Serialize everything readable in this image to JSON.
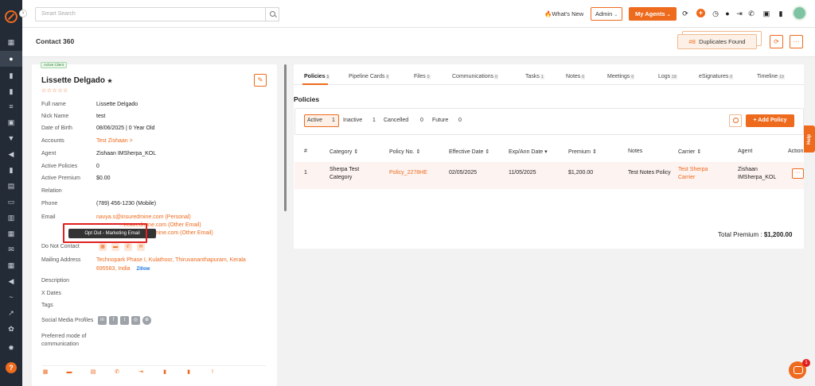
{
  "topbar": {
    "search_placeholder": "Smart Search",
    "whats_new": "What's New",
    "role": "Admin",
    "my_agents": "My Agents"
  },
  "header": {
    "title": "Contact 360",
    "duplicates_count": "#8",
    "duplicates_label": "Duplicates Found"
  },
  "contact": {
    "status": "Active Client",
    "name": "Lissette Delgado",
    "stars": "☆☆☆☆☆",
    "fields": [
      {
        "label": "Full name",
        "value": "Lissette Delgado"
      },
      {
        "label": "Nick Name",
        "value": "test"
      },
      {
        "label": "Date of Birth",
        "value": "08/06/2025 | 0 Year Old"
      },
      {
        "label": "Accounts",
        "value": "Test Zishaan >"
      },
      {
        "label": "Agent",
        "value": "Zishaan IMSherpa_KOL"
      },
      {
        "label": "Active Policies",
        "value": "0"
      },
      {
        "label": "Active Premium",
        "value": "$0.00"
      },
      {
        "label": "Relation",
        "value": ""
      },
      {
        "label": "Phone",
        "value": "(789) 456-1230 (Mobile)"
      }
    ],
    "email_label": "Email",
    "emails": [
      "navya.s@insuredmine.com  (Personal)",
      "...insuredmine.com  (Other Email)",
      "...mine.com  (Other Email)"
    ],
    "tooltip": "Opt Out - Marketing Email",
    "dnc_label": "Do Not Contact",
    "mailing_label": "Mailing Address",
    "mailing_line1": "Technopark Phase I, Kulathoor, Thiruvananthapuram, Kerala",
    "mailing_line2": "695583, India",
    "zillow": "Zillow",
    "description_label": "Description",
    "xdates_label": "X Dates",
    "tags_label": "Tags",
    "social_label": "Social Media Profiles",
    "preferred_label1": "Preferred mode of",
    "preferred_label2": "communication"
  },
  "tabs": [
    {
      "label": "Policies",
      "count": "1"
    },
    {
      "label": "Pipeline Cards",
      "count": "0"
    },
    {
      "label": "Files",
      "count": "0"
    },
    {
      "label": "Communications",
      "count": "0"
    },
    {
      "label": "Tasks",
      "count": "1"
    },
    {
      "label": "Notes",
      "count": "0"
    },
    {
      "label": "Meetings",
      "count": "0"
    },
    {
      "label": "Logs",
      "count": "18"
    },
    {
      "label": "eSignatures",
      "count": "0"
    },
    {
      "label": "Timeline",
      "count": "19"
    }
  ],
  "policies": {
    "title": "Policies",
    "filters": [
      {
        "label": "Active",
        "count": "1"
      },
      {
        "label": "Inactive",
        "count": "1"
      },
      {
        "label": "Cancelled",
        "count": "0"
      },
      {
        "label": "Future",
        "count": "0"
      }
    ],
    "add_label": "+ Add Policy",
    "columns": [
      "#",
      "Category ⇕",
      "Policy No. ⇕",
      "Effective Date ⇕",
      "Exp/Ann Date ▾",
      "Premium ⇕",
      "Notes",
      "Carrier ⇕",
      "Agent",
      "Action"
    ],
    "row": {
      "num": "1",
      "category_line1": "Sherpa Test",
      "category_line2": "Category",
      "policy_no": "Policy_2278HE",
      "effective": "02/05/2025",
      "exp": "11/05/2025",
      "premium": "$1,200.00",
      "notes": "Test Notes Policy",
      "carrier_line1": "Test Sherpa",
      "carrier_line2": "Carrier",
      "agent_line1": "Zishaan",
      "agent_line2": "IMSherpa_KOL",
      "action": "···"
    },
    "total_label": "Total Premium :",
    "total_value": "$1,200.00"
  },
  "help_label": "Help",
  "chat_badge": "1",
  "colors": {
    "accent": "#ee6a1d",
    "sidebar": "#232b36"
  }
}
